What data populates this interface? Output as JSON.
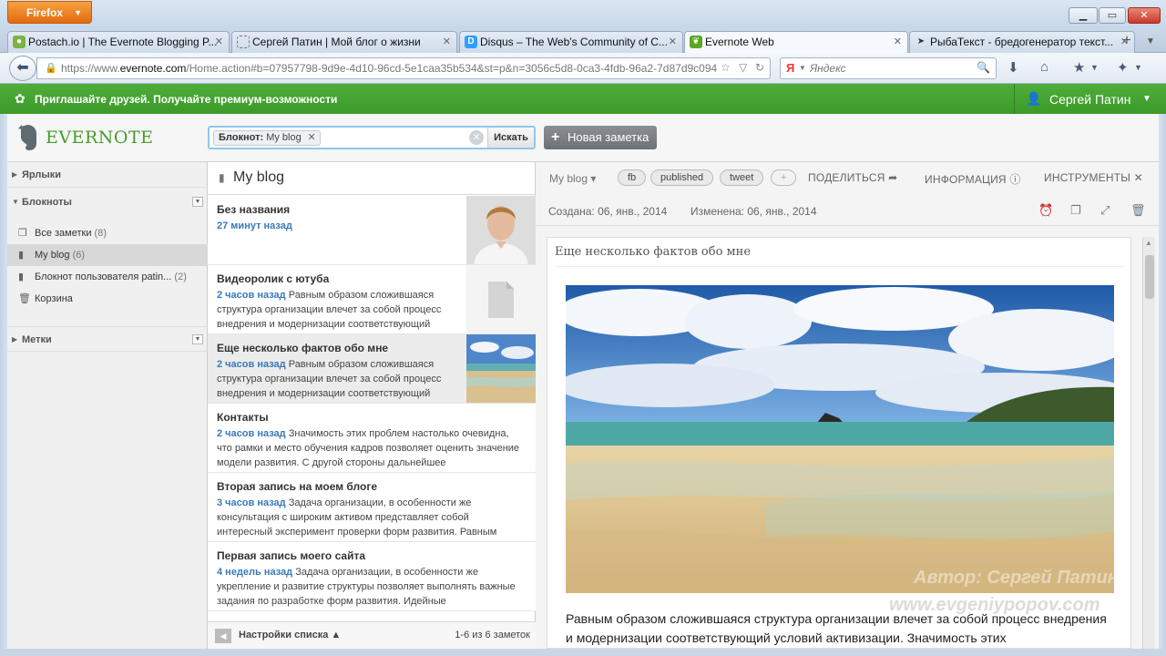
{
  "browser": {
    "menu_label": "Firefox",
    "window_controls": {
      "minimize": "▁",
      "maximize": "▭",
      "close": "✕"
    },
    "tabs": [
      {
        "label": "Postach.io | The Evernote Blogging P...",
        "icon": "postachio-icon",
        "icon_color": "#7cb342",
        "active": false
      },
      {
        "label": "Сергей Патин | Мой блог о жизни",
        "icon": "blank-page-icon",
        "icon_color": "#ffffff",
        "active": false
      },
      {
        "label": "Disqus – The Web's Community of C...",
        "icon": "disqus-icon",
        "icon_color": "#2e9fff",
        "active": false
      },
      {
        "label": "Evernote Web",
        "icon": "evernote-icon",
        "icon_color": "#5ba525",
        "active": true
      },
      {
        "label": "РыбаТекст - бредогенератор текст...",
        "icon": "fish-icon",
        "icon_color": "#333333",
        "active": false
      }
    ],
    "url": {
      "prefix": "https://www.",
      "domain": "evernote.com",
      "rest": "/Home.action#b=07957798-9d9e-4d10-96cd-5e1caa35b534&st=p&n=3056c5d8-0ca3-4fdb-96a2-7d87d9c094"
    },
    "search": {
      "placeholder": "Яндекс",
      "engine_letter": "Я"
    }
  },
  "promo_bar": {
    "text": "Приглашайте друзей. Получайте премиум-возможности",
    "user_name": "Сергей Патин"
  },
  "app": {
    "logo_text": "EVERNOTE",
    "search_filter_label": "Блокнот:",
    "search_filter_value": "My blog",
    "search_button": "Искать",
    "new_note_button": "Новая заметка"
  },
  "sidebar": {
    "shortcuts_label": "Ярлыки",
    "notebooks_label": "Блокноты",
    "notebooks": [
      {
        "label": "Все заметки",
        "count": "(8)",
        "icon": "all-notes-icon",
        "selected": false
      },
      {
        "label": "My blog",
        "count": "(6)",
        "icon": "notebook-icon",
        "selected": true
      },
      {
        "label": "Блокнот пользователя patin...",
        "count": "(2)",
        "icon": "notebook-icon",
        "selected": false
      },
      {
        "label": "Корзина",
        "count": "",
        "icon": "trash-icon",
        "selected": false
      }
    ],
    "tags_label": "Метки"
  },
  "note_list": {
    "title": "My blog",
    "notes": [
      {
        "title": "Без названия",
        "time": "27 минут назад",
        "snippet": "",
        "thumb": "portrait"
      },
      {
        "title": "Видеоролик с ютуба",
        "time": "2 часов назад",
        "snippet": "Равным образом сложившаяся структура организации влечет за собой процесс внедрения и модернизации соответствующий",
        "thumb": "document"
      },
      {
        "title": "Еще несколько фактов обо мне",
        "time": "2 часов назад",
        "snippet": "Равным образом сложившаяся структура организации влечет за собой процесс внедрения и модернизации соответствующий",
        "thumb": "beach",
        "selected": true
      },
      {
        "title": "Контакты",
        "time": "2 часов назад",
        "snippet": "Значимость этих проблем настолько очевидна, что рамки и место обучения кадров позволяет оценить значение модели развития. С другой стороны дальнейшее",
        "thumb": ""
      },
      {
        "title": "Вторая запись на моем блоге",
        "time": "3 часов назад",
        "snippet": "Задача организации, в особенности же консультация с широким активом представляет собой интересный эксперимент проверки форм развития. Равным",
        "thumb": ""
      },
      {
        "title": "Первая запись моего сайта",
        "time": "4 недель назад",
        "snippet": "Задача организации, в особенности же укрепление и развитие структуры позволяет выполнять важные задания по разработке форм развития. Идейные",
        "thumb": ""
      }
    ],
    "settings_label": "Настройки списка",
    "count_label": "1-6 из 6 заметок"
  },
  "note": {
    "notebook": "My blog",
    "tags": [
      "fb",
      "published",
      "tweet",
      "+"
    ],
    "share_label": "ПОДЕЛИТЬСЯ",
    "info_label": "ИНФОРМАЦИЯ",
    "tools_label": "ИНСТРУМЕНТЫ",
    "created": "Создана: 06, янв., 2014",
    "modified": "Изменена: 06, янв., 2014",
    "heading": "Еще несколько фактов обо мне",
    "watermark_author": "Автор: Сергей Патин",
    "watermark_site": "www.evgeniypopov.com",
    "paragraph": "Равным образом сложившаяся структура организации влечет за собой процесс внедрения и модернизации соответствующий условий активизации. Значимость этих"
  }
}
